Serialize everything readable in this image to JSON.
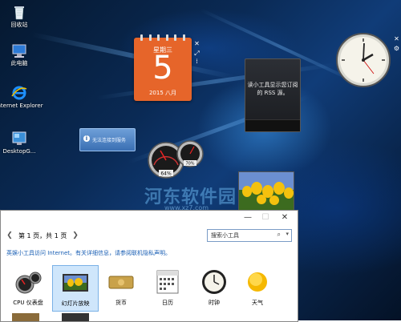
{
  "desktop_icons": [
    {
      "label": "回收站",
      "icon": "recycle-bin-icon"
    },
    {
      "label": "此电脑",
      "icon": "computer-icon"
    },
    {
      "label": "Internet Explorer",
      "icon": "ie-icon"
    },
    {
      "label": "DesktopG...",
      "icon": "desktop-gadgets-icon"
    }
  ],
  "calendar_gadget": {
    "weekday": "星期三",
    "day": "5",
    "year_month": "2015 八月"
  },
  "rss_gadget": {
    "message": "读小工具显示您订阅的 RSS 源。"
  },
  "notice": {
    "text": "无法连接到服务"
  },
  "cpu_gadget": {
    "cpu": "64%",
    "mem": "70%"
  },
  "watermark": {
    "text": "河东软件园",
    "url": "www.xz7.com"
  },
  "dialog": {
    "page_label": "第 1 页，共 1 页",
    "search_placeholder": "搜索小工具",
    "online_link": "英娱小工具访问 Internet。有关详细信息，请参阅联机隐私声明。",
    "gadgets": [
      {
        "label": "CPU 仪表盘",
        "icon": "cpu-meter-icon"
      },
      {
        "label": "幻灯片放映",
        "icon": "slideshow-icon"
      },
      {
        "label": "货币",
        "icon": "currency-icon"
      },
      {
        "label": "日历",
        "icon": "calendar-icon"
      },
      {
        "label": "时钟",
        "icon": "clock-icon"
      },
      {
        "label": "天气",
        "icon": "weather-icon"
      }
    ]
  },
  "colors": {
    "calendar_orange": "#e6652a",
    "link_blue": "#1a5fb4",
    "selection": "#cfe6fb"
  }
}
